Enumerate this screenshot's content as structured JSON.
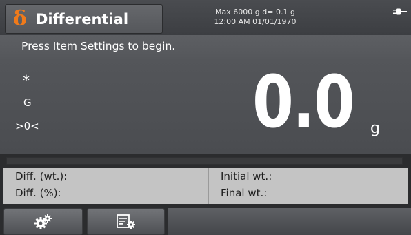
{
  "header": {
    "app_icon": "delta-sigma-icon",
    "app_title": "Differential",
    "capacity": "Max 6000 g  d= 0.1 g",
    "datetime": "12:00 AM   01/01/1970",
    "power_icon": "ac-plug-icon"
  },
  "prompt": "Press Item Settings to begin.",
  "indicators": {
    "stable": "*",
    "gross": "G",
    "center_zero": ">0<"
  },
  "display": {
    "reading": "0.0",
    "unit": "g",
    "capacity_bar_fraction": 0
  },
  "readouts": {
    "diff_wt_label": "Diff. (wt.):",
    "diff_pct_label": "Diff. (%):",
    "initial_wt_label": "Initial wt.:",
    "final_wt_label": "Final wt.:"
  },
  "softkeys": [
    {
      "name": "settings",
      "icon": "gears-icon"
    },
    {
      "name": "item-settings",
      "icon": "item-settings-icon"
    }
  ],
  "colors": {
    "accent": "#f07a1a",
    "background": "#2b2c2e",
    "panel": "#4e5054",
    "readout_panel": "#c4c4c4"
  }
}
